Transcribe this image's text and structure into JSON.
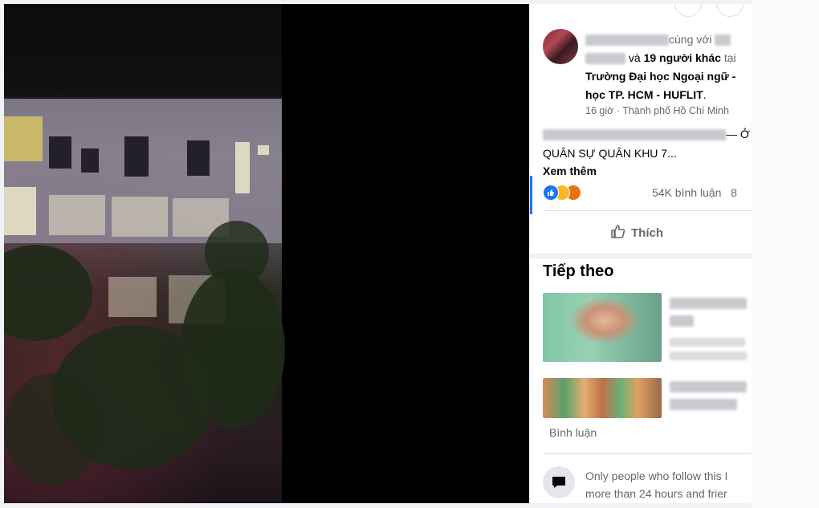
{
  "post": {
    "with_text": "cùng với",
    "and_text": "và",
    "others_count": "19 người khác",
    "at_text": "tại",
    "place_line1": "Trường Đại học Ngoại ngữ -",
    "place_line2": "học TP. HCM - HUFLIT",
    "place_punct": ".",
    "time": "16 giờ",
    "dot": "·",
    "location": "Thành phố Hồ Chí Minh",
    "text_dash": "— Ở",
    "text_line2": "QUÂN SỰ QUÂN KHU 7...",
    "see_more": "Xem thêm",
    "comments_count": "54K bình luận",
    "shares_partial": "8"
  },
  "actions": {
    "like_label": "Thích"
  },
  "next_section": {
    "title": "Tiếp theo"
  },
  "comments": {
    "label": "Bình luận",
    "notice_line1": "Only people who follow this I",
    "notice_line2": "more than 24 hours and frier"
  },
  "colors": {
    "accent": "#1877f2",
    "like_reaction": "#1877f2",
    "haha_reaction": "#f7b928",
    "angry_reaction": "#e9710f"
  },
  "icons": [
    "like-reaction-icon",
    "haha-reaction-icon",
    "angry-reaction-icon",
    "thumbs-up-icon",
    "comment-bubble-icon"
  ]
}
